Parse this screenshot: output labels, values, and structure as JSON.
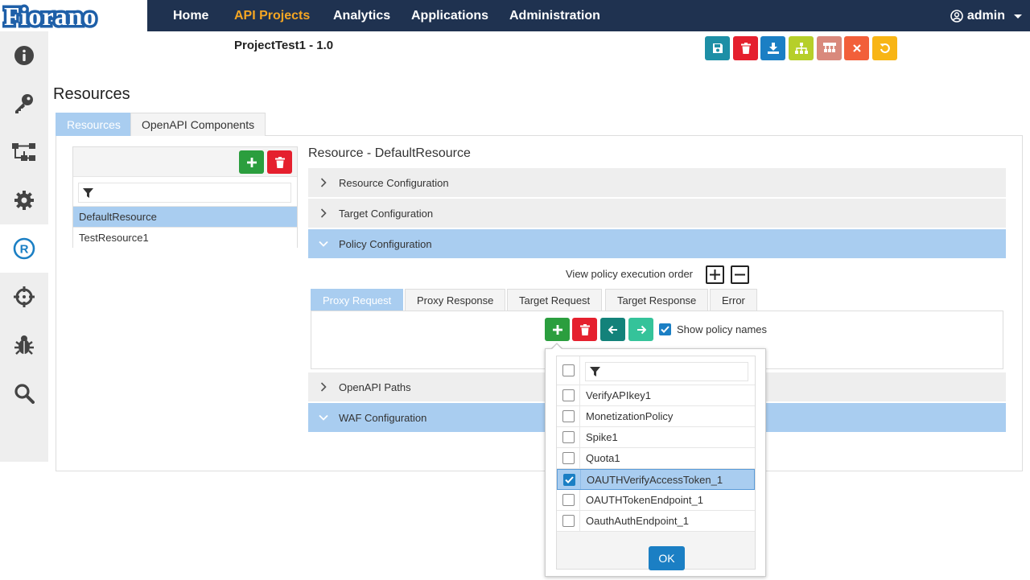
{
  "brand": {
    "logo_text": "Fiorano"
  },
  "nav": {
    "items": [
      {
        "label": "Home"
      },
      {
        "label": "API Projects"
      },
      {
        "label": "Analytics"
      },
      {
        "label": "Applications"
      },
      {
        "label": "Administration"
      }
    ],
    "active": "API Projects",
    "user": "admin"
  },
  "sidebar": {
    "icons": [
      "info-icon",
      "key-icon",
      "flow-icon",
      "gear-icon",
      "registered-icon",
      "crosshair-icon",
      "bug-icon",
      "search-icon"
    ],
    "active": "registered-icon"
  },
  "project": {
    "title": "ProjectTest1 - 1.0"
  },
  "toolbar": {
    "buttons": [
      "save-icon",
      "delete-icon",
      "download-icon",
      "hierarchy-icon",
      "deploy-icon",
      "close-icon",
      "undo-icon"
    ]
  },
  "page": {
    "title": "Resources"
  },
  "tabs": [
    {
      "label": "Resources",
      "active": true
    },
    {
      "label": "OpenAPI Components",
      "active": false
    }
  ],
  "resources": {
    "filter_placeholder": "",
    "items": [
      {
        "label": "DefaultResource",
        "selected": true
      },
      {
        "label": "TestResource1",
        "selected": false
      }
    ]
  },
  "detail": {
    "heading": "Resource - DefaultResource",
    "sections": {
      "resource_config": "Resource Configuration",
      "target_config": "Target Configuration",
      "policy_config": "Policy Configuration",
      "openapi_paths": "OpenAPI Paths",
      "waf_config": "WAF Configuration"
    },
    "exec_order_label": "View policy execution order",
    "policy_tabs": [
      {
        "label": "Proxy Request",
        "active": true
      },
      {
        "label": "Proxy Response",
        "active": false
      },
      {
        "label": "Target Request",
        "active": false
      },
      {
        "label": "Target Response",
        "active": false
      },
      {
        "label": "Error",
        "active": false
      }
    ],
    "show_policy_names": {
      "label": "Show policy names",
      "checked": true
    }
  },
  "popup": {
    "filter_placeholder": "",
    "policies": [
      {
        "label": "VerifyAPIkey1",
        "checked": false
      },
      {
        "label": "MonetizationPolicy",
        "checked": false
      },
      {
        "label": "Spike1",
        "checked": false
      },
      {
        "label": "Quota1",
        "checked": false
      },
      {
        "label": "OAUTHVerifyAccessToken_1",
        "checked": true
      },
      {
        "label": "OAUTHTokenEndpoint_1",
        "checked": false
      },
      {
        "label": "OauthAuthEndpoint_1",
        "checked": false
      }
    ],
    "ok_label": "OK"
  },
  "colors": {
    "navbar": "#1f3250",
    "nav_active": "#f5a623",
    "selection": "#a9cdf0",
    "primary": "#1b7fc4",
    "success": "#2b9e3e",
    "danger": "#e5202e"
  }
}
